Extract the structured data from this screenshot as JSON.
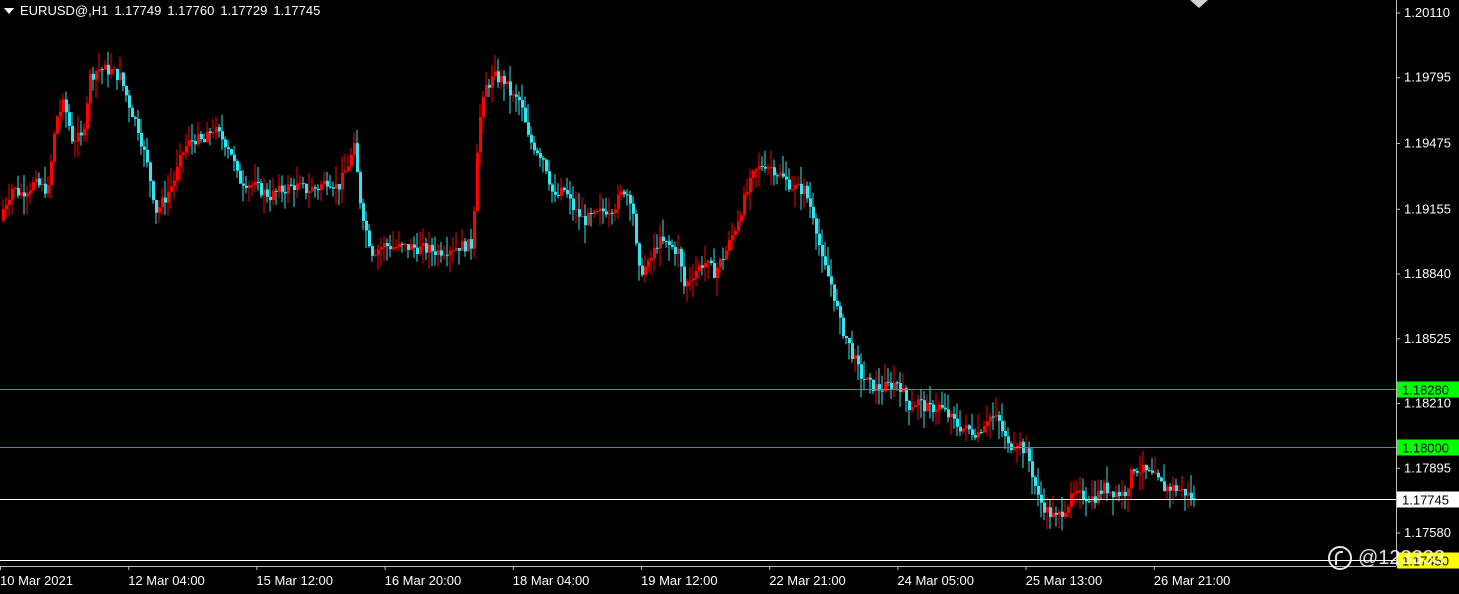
{
  "header": {
    "symbol": "EURUSD@,H1",
    "open": "1.17749",
    "high": "1.17760",
    "low": "1.17729",
    "close": "1.17745",
    "dropdown_icon": "chevron-down-icon"
  },
  "watermark": {
    "text": "@123333",
    "icon": "logo-glyph"
  },
  "colors": {
    "background": "#000000",
    "bull": "#ff0000",
    "bear": "#33e5ee",
    "grid_axis": "#c0c0c0",
    "level_line": "#00cc00",
    "level_label_bg": "#00ff00",
    "price_line": "#ffffff",
    "bottom_label_bg": "#ffff00"
  },
  "chart_data": {
    "type": "candlestick",
    "title": "EURUSD@,H1",
    "x_tick_labels": [
      "10 Mar 2021",
      "12 Mar 04:00",
      "15 Mar 12:00",
      "16 Mar 20:00",
      "18 Mar 04:00",
      "19 Mar 12:00",
      "22 Mar 21:00",
      "24 Mar 05:00",
      "25 Mar 13:00",
      "26 Mar 21:00"
    ],
    "y_tick_labels": [
      "1.20110",
      "1.19795",
      "1.19475",
      "1.19155",
      "1.18840",
      "1.18525",
      "1.18210",
      "1.17895",
      "1.17580"
    ],
    "ylim": [
      1.1726,
      1.2022
    ],
    "horizontal_levels": [
      {
        "value": 1.1828,
        "label": "1.18280",
        "kind": "level"
      },
      {
        "value": 1.18,
        "label": "1.18000",
        "kind": "level"
      },
      {
        "value": 1.17745,
        "label": "1.17745",
        "kind": "current"
      },
      {
        "value": 1.1745,
        "label": "1.17450",
        "kind": "bottom"
      }
    ],
    "last_candle": {
      "open": 1.17749,
      "high": 1.1776,
      "low": 1.17729,
      "close": 1.17745
    },
    "price_path": [
      [
        0,
        1.191
      ],
      [
        14,
        1.1926
      ],
      [
        22,
        1.1923
      ],
      [
        36,
        1.1928
      ],
      [
        50,
        1.1925
      ],
      [
        58,
        1.196
      ],
      [
        66,
        1.1967
      ],
      [
        74,
        1.195
      ],
      [
        84,
        1.195
      ],
      [
        92,
        1.198
      ],
      [
        100,
        1.1984
      ],
      [
        112,
        1.1983
      ],
      [
        122,
        1.198
      ],
      [
        132,
        1.1965
      ],
      [
        140,
        1.1955
      ],
      [
        150,
        1.1935
      ],
      [
        158,
        1.1915
      ],
      [
        166,
        1.192
      ],
      [
        176,
        1.193
      ],
      [
        186,
        1.1945
      ],
      [
        196,
        1.195
      ],
      [
        206,
        1.1948
      ],
      [
        214,
        1.1955
      ],
      [
        224,
        1.195
      ],
      [
        232,
        1.1945
      ],
      [
        240,
        1.193
      ],
      [
        252,
        1.1928
      ],
      [
        262,
        1.1925
      ],
      [
        272,
        1.1922
      ],
      [
        284,
        1.1925
      ],
      [
        296,
        1.1927
      ],
      [
        308,
        1.1925
      ],
      [
        320,
        1.1926
      ],
      [
        330,
        1.193
      ],
      [
        340,
        1.1926
      ],
      [
        348,
        1.1935
      ],
      [
        356,
        1.1945
      ],
      [
        362,
        1.192
      ],
      [
        368,
        1.1905
      ],
      [
        374,
        1.1895
      ],
      [
        386,
        1.1898
      ],
      [
        400,
        1.1897
      ],
      [
        414,
        1.1897
      ],
      [
        428,
        1.1896
      ],
      [
        440,
        1.1895
      ],
      [
        454,
        1.1897
      ],
      [
        468,
        1.1898
      ],
      [
        474,
        1.1898
      ],
      [
        480,
        1.1955
      ],
      [
        488,
        1.1975
      ],
      [
        496,
        1.198
      ],
      [
        506,
        1.1978
      ],
      [
        514,
        1.197
      ],
      [
        522,
        1.1968
      ],
      [
        530,
        1.195
      ],
      [
        538,
        1.1945
      ],
      [
        546,
        1.194
      ],
      [
        556,
        1.192
      ],
      [
        566,
        1.1925
      ],
      [
        576,
        1.1915
      ],
      [
        586,
        1.191
      ],
      [
        596,
        1.1912
      ],
      [
        606,
        1.1915
      ],
      [
        616,
        1.1917
      ],
      [
        626,
        1.1925
      ],
      [
        634,
        1.192
      ],
      [
        640,
        1.1885
      ],
      [
        650,
        1.1888
      ],
      [
        660,
        1.19
      ],
      [
        670,
        1.1898
      ],
      [
        680,
        1.1895
      ],
      [
        686,
        1.1878
      ],
      [
        696,
        1.1885
      ],
      [
        706,
        1.189
      ],
      [
        716,
        1.1885
      ],
      [
        726,
        1.1893
      ],
      [
        736,
        1.1905
      ],
      [
        746,
        1.192
      ],
      [
        756,
        1.1933
      ],
      [
        766,
        1.1938
      ],
      [
        776,
        1.1935
      ],
      [
        786,
        1.193
      ],
      [
        796,
        1.1926
      ],
      [
        806,
        1.1925
      ],
      [
        816,
        1.1912
      ],
      [
        824,
        1.189
      ],
      [
        834,
        1.1878
      ],
      [
        842,
        1.186
      ],
      [
        852,
        1.1848
      ],
      [
        862,
        1.1835
      ],
      [
        872,
        1.183
      ],
      [
        882,
        1.1828
      ],
      [
        892,
        1.183
      ],
      [
        900,
        1.1832
      ],
      [
        910,
        1.182
      ],
      [
        920,
        1.1822
      ],
      [
        930,
        1.1818
      ],
      [
        940,
        1.182
      ],
      [
        950,
        1.1815
      ],
      [
        960,
        1.181
      ],
      [
        970,
        1.1808
      ],
      [
        980,
        1.1807
      ],
      [
        990,
        1.1815
      ],
      [
        1000,
        1.1813
      ],
      [
        1010,
        1.18
      ],
      [
        1020,
        1.1803
      ],
      [
        1030,
        1.1795
      ],
      [
        1040,
        1.1775
      ],
      [
        1050,
        1.1768
      ],
      [
        1058,
        1.1765
      ],
      [
        1066,
        1.177
      ],
      [
        1076,
        1.1776
      ],
      [
        1086,
        1.1776
      ],
      [
        1096,
        1.1775
      ],
      [
        1106,
        1.178
      ],
      [
        1116,
        1.1778
      ],
      [
        1126,
        1.1777
      ],
      [
        1136,
        1.179
      ],
      [
        1146,
        1.1788
      ],
      [
        1156,
        1.1785
      ],
      [
        1166,
        1.178
      ],
      [
        1176,
        1.178
      ],
      [
        1186,
        1.1778
      ],
      [
        1194,
        1.1775
      ]
    ]
  }
}
